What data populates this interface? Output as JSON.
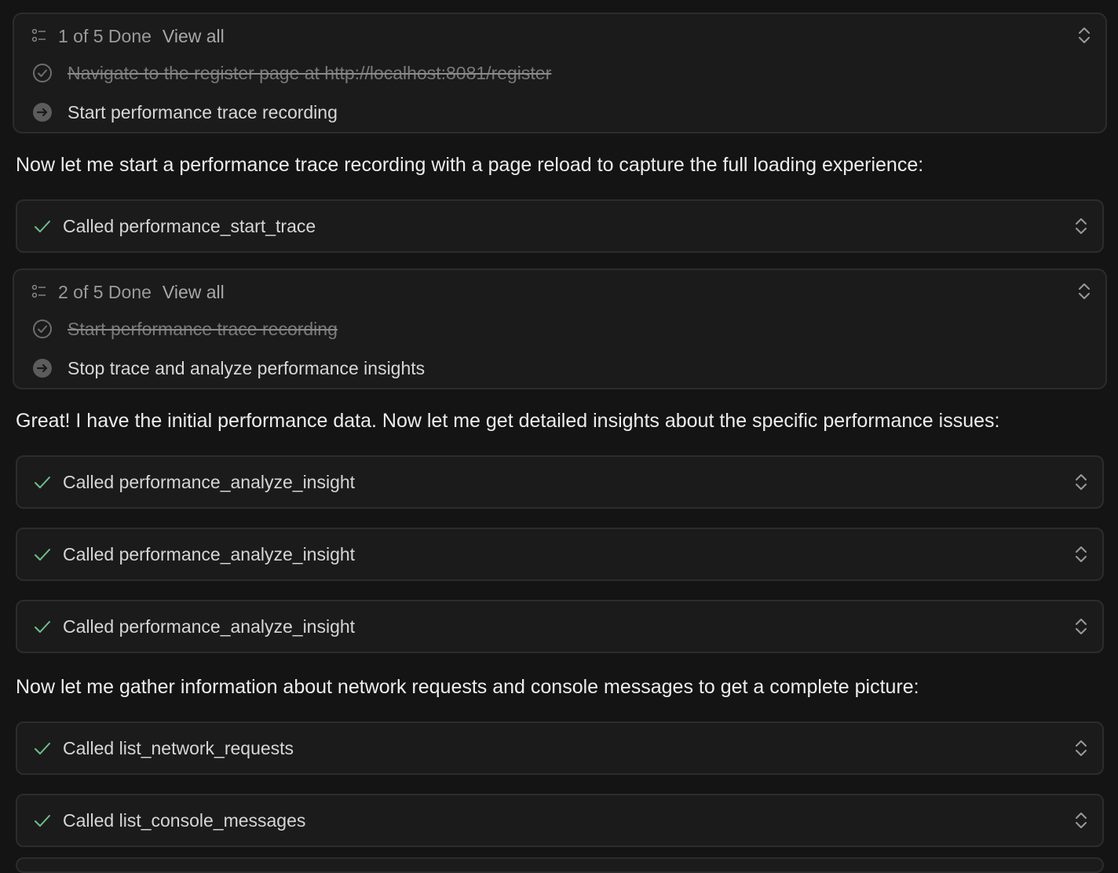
{
  "todo_panels": [
    {
      "progress": "1 of 5 Done",
      "view_all": "View all",
      "items": [
        {
          "text": "Navigate to the register page at http://localhost:8081/register",
          "status": "done"
        },
        {
          "text": "Start performance trace recording",
          "status": "current"
        }
      ]
    },
    {
      "progress": "2 of 5 Done",
      "view_all": "View all",
      "items": [
        {
          "text": "Start performance trace recording",
          "status": "done"
        },
        {
          "text": "Stop trace and analyze performance insights",
          "status": "current"
        }
      ]
    }
  ],
  "messages": [
    "Now let me start a performance trace recording with a page reload to capture the full loading experience:",
    "Great! I have the initial performance data. Now let me get detailed insights about the specific performance issues:",
    "Now let me gather information about network requests and console messages to get a complete picture:"
  ],
  "tool_calls": [
    {
      "label": "Called performance_start_trace"
    },
    {
      "label": "Called performance_analyze_insight"
    },
    {
      "label": "Called performance_analyze_insight"
    },
    {
      "label": "Called performance_analyze_insight"
    },
    {
      "label": "Called list_network_requests"
    },
    {
      "label": "Called list_console_messages"
    }
  ],
  "colors": {
    "background": "#141414",
    "panel": "#1b1b1b",
    "border": "#2c2c2c",
    "check": "#6fbf8a",
    "muted_text": "#7a7a7a"
  },
  "icons": {
    "list": "checklist-icon",
    "done": "circle-check-icon",
    "current": "circle-arrow-right-icon",
    "tool_done": "check-icon",
    "expand": "chevron-up-down-icon"
  }
}
